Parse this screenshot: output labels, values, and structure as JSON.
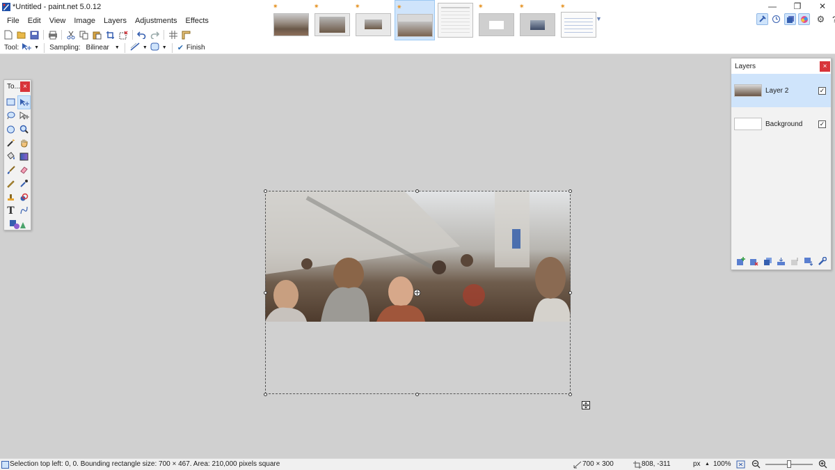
{
  "window": {
    "title": "*Untitled - paint.net 5.0.12",
    "controls": {
      "minimize": "—",
      "restore": "❐",
      "close": "✕"
    }
  },
  "menu": [
    "File",
    "Edit",
    "View",
    "Image",
    "Layers",
    "Adjustments",
    "Effects"
  ],
  "toolbar": {
    "tool_label": "Tool:",
    "sampling_label": "Sampling:",
    "sampling_value": "Bilinear",
    "finish_label": "Finish"
  },
  "thumbnails": [
    {
      "selected": false,
      "icon": "photo-thumb"
    },
    {
      "selected": false,
      "icon": "photo-thumb"
    },
    {
      "selected": false,
      "icon": "photo-thumb"
    },
    {
      "selected": true,
      "icon": "photo-thumb"
    },
    {
      "selected": false,
      "icon": "dialog-thumb"
    },
    {
      "selected": false,
      "icon": "dialog-thumb"
    },
    {
      "selected": false,
      "icon": "photo-thumb"
    },
    {
      "selected": false,
      "icon": "document-thumb"
    }
  ],
  "tools_window": {
    "title": "To...",
    "close": "×"
  },
  "layers_window": {
    "title": "Layers",
    "close": "×",
    "layers": [
      {
        "name": "Layer 2",
        "visible": true,
        "selected": true
      },
      {
        "name": "Background",
        "visible": true,
        "selected": false
      }
    ]
  },
  "status": {
    "selection_info": "Selection top left: 0, 0. Bounding rectangle size: 700 × 467. Area: 210,000 pixels square",
    "image_size": "700 × 300",
    "cursor_pos": "808, -311",
    "units": "px",
    "zoom": "100%",
    "zoom_slider": 0.5
  },
  "colors": {
    "accent": "#cfe4fb",
    "close_red": "#d8343a",
    "canvas_bg": "#d0d0d0"
  }
}
